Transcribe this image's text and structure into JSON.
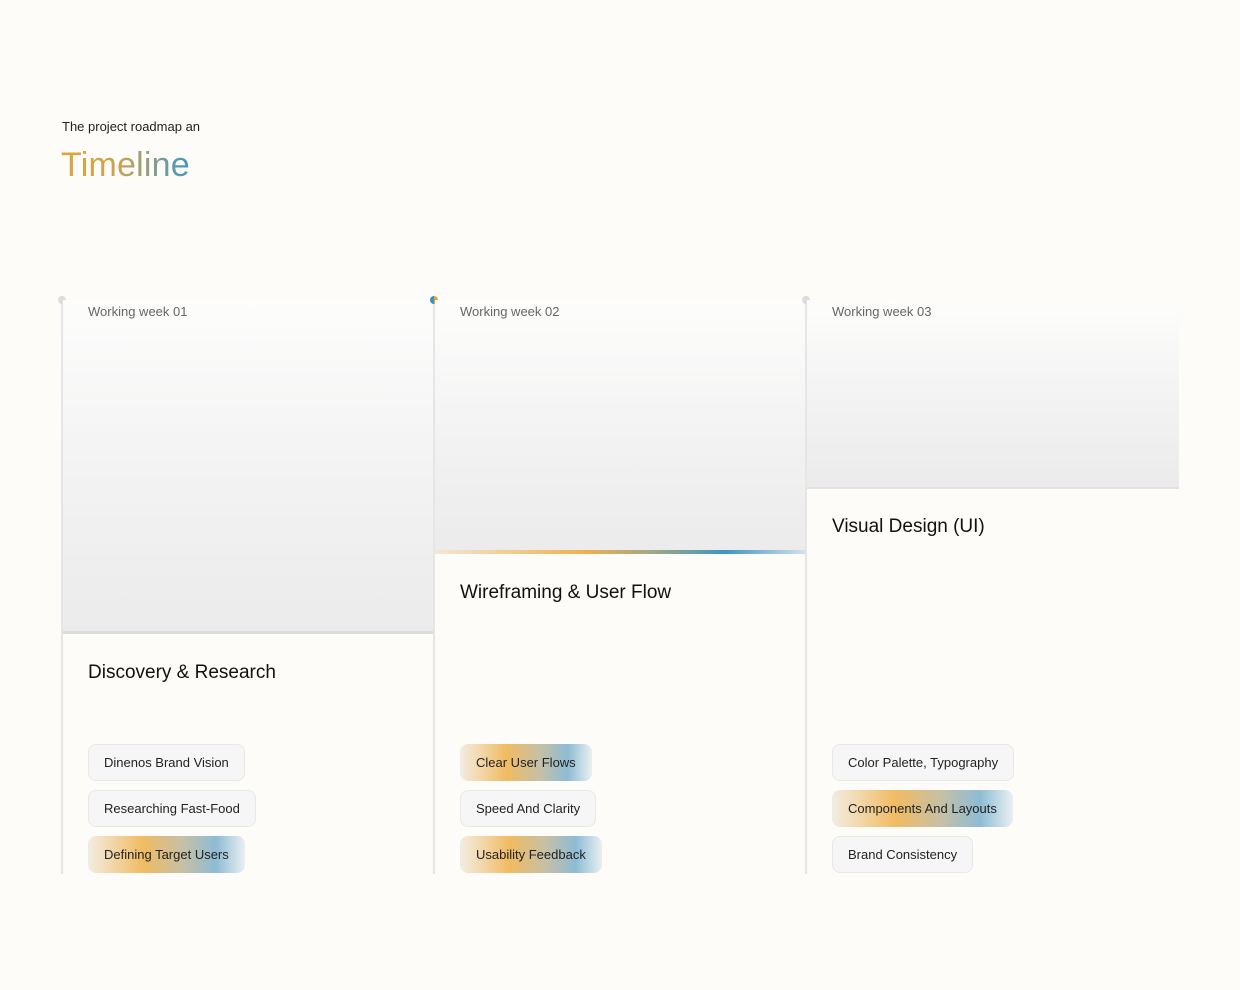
{
  "header": {
    "eyebrow": "The project roadmap an",
    "title": "Timeline"
  },
  "colors": {
    "background": "#fdfcf8",
    "accent_orange": "#e8a33a",
    "accent_blue": "#3f8fba"
  },
  "weeks": [
    {
      "label": "Working week 01",
      "phase": "Discovery & Research",
      "active": false,
      "chips": [
        "Dinenos Brand Vision",
        "Researching Fast-Food",
        "Defining Target Users"
      ],
      "highlighted_chip_index": 2
    },
    {
      "label": "Working week 02",
      "phase": "Wireframing & User Flow",
      "active": true,
      "chips": [
        "Clear User Flows",
        "Speed And Clarity",
        "Usability Feedback"
      ],
      "highlighted_chip_indexes": [
        0,
        2
      ]
    },
    {
      "label": "Working week 03",
      "phase": "Visual Design (UI)",
      "active": false,
      "chips": [
        "Color Palette, Typography",
        "Components And Layouts",
        "Brand Consistency"
      ],
      "highlighted_chip_index": 1
    }
  ]
}
